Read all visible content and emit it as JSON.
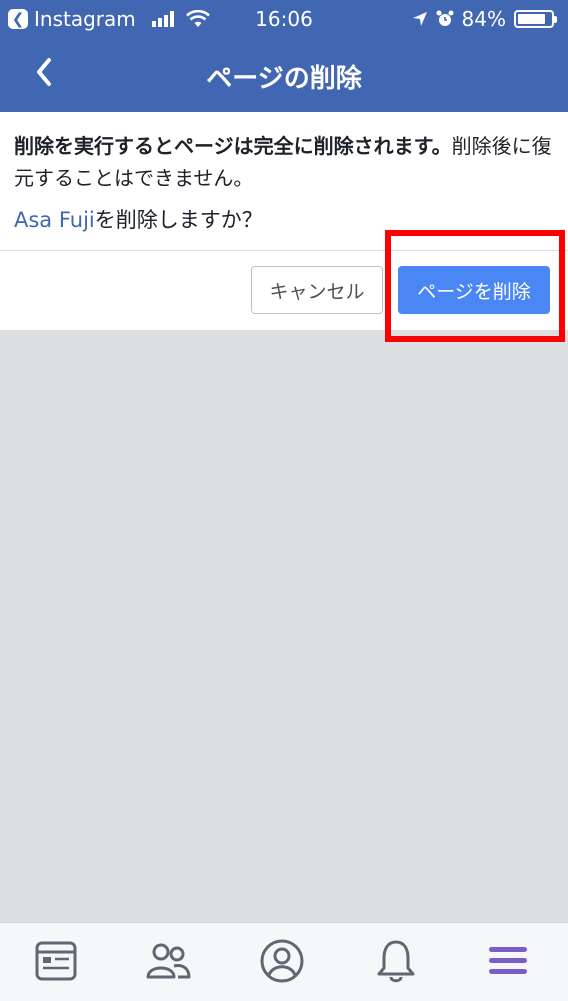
{
  "status_bar": {
    "back_app_label": "Instagram",
    "time": "16:06",
    "battery": "84%",
    "battery_level": 0.84
  },
  "nav": {
    "title": "ページの削除"
  },
  "dialog": {
    "message_bold": "削除を実行するとページは完全に削除されます。",
    "message_rest": "削除後に復元することはできません。",
    "page_name": "Asa Fuji",
    "question_suffix": "を削除しますか？",
    "cancel_label": "キャンセル",
    "delete_label": "ページを削除"
  },
  "tab_bar": {
    "icons": [
      "news-feed-icon",
      "friends-icon",
      "profile-icon",
      "notifications-icon",
      "menu-icon"
    ],
    "active": "menu-icon",
    "active_color": "#7b5fc9",
    "inactive_color": "#606770"
  },
  "colors": {
    "brand": "#4267b2",
    "primary_button": "#4a86f4",
    "highlight": "#ff0000"
  }
}
